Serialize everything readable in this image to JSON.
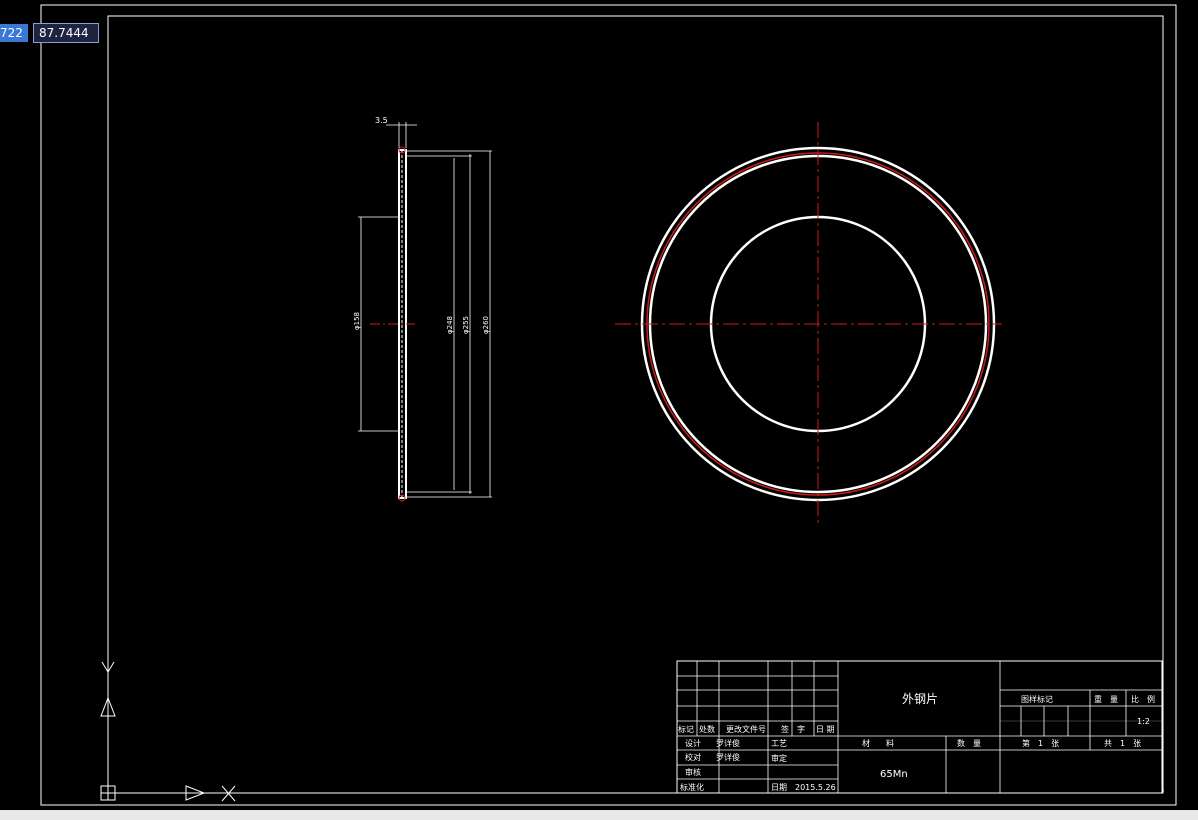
{
  "coordinates": {
    "x_partial": "722",
    "y": "87.7444"
  },
  "dimensions": {
    "thickness": "3.5",
    "d158": "φ158",
    "d248": "φ248",
    "d255": "φ255",
    "d260": "φ260"
  },
  "title_block": {
    "part_name": "外钢片",
    "material": "65Mn",
    "scale": "1:2",
    "header_row": [
      "标记",
      "处数",
      "更改文件号",
      "签　字",
      "日 期"
    ],
    "labels": {
      "design": "设计",
      "check": "校对",
      "review": "审核",
      "standard": "标准化",
      "process": "工艺",
      "approve": "审定",
      "date_label": "日期",
      "material": "材　　料",
      "quantity": "数　量",
      "drawing_mark": "图样标记",
      "weight": "重　量",
      "scale": "比　例",
      "sheet": "第　1　张",
      "total": "共　1　张"
    },
    "designer": "罗详俊",
    "checker": "罗详俊",
    "date": "2015.5.26"
  },
  "colors": {
    "line": "#ffffff",
    "centerline": "#cc1a1a",
    "background": "#000000"
  }
}
